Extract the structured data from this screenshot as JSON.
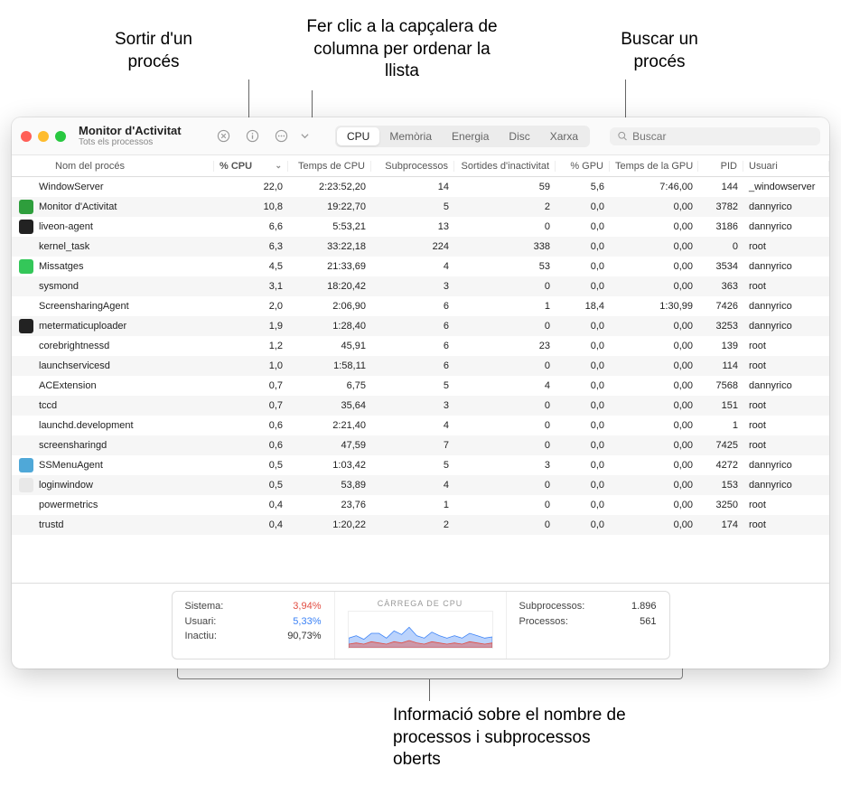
{
  "callouts": {
    "quit": "Sortir d'un\nprocés",
    "sort": "Fer clic a la capçalera\nde columna per\nordenar la llista",
    "search": "Buscar un\nprocés",
    "footer": "Informació sobre el\nnombre de processos\ni subprocessos oberts"
  },
  "titlebar": {
    "title": "Monitor d'Activitat",
    "subtitle": "Tots els processos"
  },
  "tabs": [
    "CPU",
    "Memòria",
    "Energia",
    "Disc",
    "Xarxa"
  ],
  "active_tab": 0,
  "search": {
    "placeholder": "Buscar"
  },
  "columns": [
    {
      "key": "name",
      "label": "Nom del procés"
    },
    {
      "key": "cpu",
      "label": "% CPU",
      "sorted": true
    },
    {
      "key": "cputime",
      "label": "Temps de CPU"
    },
    {
      "key": "threads",
      "label": "Subprocessos"
    },
    {
      "key": "idlewake",
      "label": "Sortides d'inactivitat"
    },
    {
      "key": "gpu",
      "label": "% GPU"
    },
    {
      "key": "gputime",
      "label": "Temps de la GPU"
    },
    {
      "key": "pid",
      "label": "PID"
    },
    {
      "key": "user",
      "label": "Usuari"
    }
  ],
  "rows": [
    {
      "icon": "",
      "name": "WindowServer",
      "cpu": "22,0",
      "cputime": "2:23:52,20",
      "threads": "14",
      "idlewake": "59",
      "gpu": "5,6",
      "gputime": "7:46,00",
      "pid": "144",
      "user": "_windowserver"
    },
    {
      "icon": "#2e9e3c",
      "name": "Monitor d'Activitat",
      "cpu": "10,8",
      "cputime": "19:22,70",
      "threads": "5",
      "idlewake": "2",
      "gpu": "0,0",
      "gputime": "0,00",
      "pid": "3782",
      "user": "dannyrico"
    },
    {
      "icon": "#222",
      "name": "liveon-agent",
      "cpu": "6,6",
      "cputime": "5:53,21",
      "threads": "13",
      "idlewake": "0",
      "gpu": "0,0",
      "gputime": "0,00",
      "pid": "3186",
      "user": "dannyrico"
    },
    {
      "icon": "",
      "name": "kernel_task",
      "cpu": "6,3",
      "cputime": "33:22,18",
      "threads": "224",
      "idlewake": "338",
      "gpu": "0,0",
      "gputime": "0,00",
      "pid": "0",
      "user": "root"
    },
    {
      "icon": "#34c759",
      "name": "Missatges",
      "cpu": "4,5",
      "cputime": "21:33,69",
      "threads": "4",
      "idlewake": "53",
      "gpu": "0,0",
      "gputime": "0,00",
      "pid": "3534",
      "user": "dannyrico"
    },
    {
      "icon": "",
      "name": "sysmond",
      "cpu": "3,1",
      "cputime": "18:20,42",
      "threads": "3",
      "idlewake": "0",
      "gpu": "0,0",
      "gputime": "0,00",
      "pid": "363",
      "user": "root"
    },
    {
      "icon": "",
      "name": "ScreensharingAgent",
      "cpu": "2,0",
      "cputime": "2:06,90",
      "threads": "6",
      "idlewake": "1",
      "gpu": "18,4",
      "gputime": "1:30,99",
      "pid": "7426",
      "user": "dannyrico"
    },
    {
      "icon": "#222",
      "name": "metermaticuploader",
      "cpu": "1,9",
      "cputime": "1:28,40",
      "threads": "6",
      "idlewake": "0",
      "gpu": "0,0",
      "gputime": "0,00",
      "pid": "3253",
      "user": "dannyrico"
    },
    {
      "icon": "",
      "name": "corebrightnessd",
      "cpu": "1,2",
      "cputime": "45,91",
      "threads": "6",
      "idlewake": "23",
      "gpu": "0,0",
      "gputime": "0,00",
      "pid": "139",
      "user": "root"
    },
    {
      "icon": "",
      "name": "launchservicesd",
      "cpu": "1,0",
      "cputime": "1:58,11",
      "threads": "6",
      "idlewake": "0",
      "gpu": "0,0",
      "gputime": "0,00",
      "pid": "114",
      "user": "root"
    },
    {
      "icon": "",
      "name": "ACExtension",
      "cpu": "0,7",
      "cputime": "6,75",
      "threads": "5",
      "idlewake": "4",
      "gpu": "0,0",
      "gputime": "0,00",
      "pid": "7568",
      "user": "dannyrico"
    },
    {
      "icon": "",
      "name": "tccd",
      "cpu": "0,7",
      "cputime": "35,64",
      "threads": "3",
      "idlewake": "0",
      "gpu": "0,0",
      "gputime": "0,00",
      "pid": "151",
      "user": "root"
    },
    {
      "icon": "",
      "name": "launchd.development",
      "cpu": "0,6",
      "cputime": "2:21,40",
      "threads": "4",
      "idlewake": "0",
      "gpu": "0,0",
      "gputime": "0,00",
      "pid": "1",
      "user": "root"
    },
    {
      "icon": "",
      "name": "screensharingd",
      "cpu": "0,6",
      "cputime": "47,59",
      "threads": "7",
      "idlewake": "0",
      "gpu": "0,0",
      "gputime": "0,00",
      "pid": "7425",
      "user": "root"
    },
    {
      "icon": "#4fa8d8",
      "name": "SSMenuAgent",
      "cpu": "0,5",
      "cputime": "1:03,42",
      "threads": "5",
      "idlewake": "3",
      "gpu": "0,0",
      "gputime": "0,00",
      "pid": "4272",
      "user": "dannyrico"
    },
    {
      "icon": "#e8e8e8",
      "name": "loginwindow",
      "cpu": "0,5",
      "cputime": "53,89",
      "threads": "4",
      "idlewake": "0",
      "gpu": "0,0",
      "gputime": "0,00",
      "pid": "153",
      "user": "dannyrico"
    },
    {
      "icon": "",
      "name": "powermetrics",
      "cpu": "0,4",
      "cputime": "23,76",
      "threads": "1",
      "idlewake": "0",
      "gpu": "0,0",
      "gputime": "0,00",
      "pid": "3250",
      "user": "root"
    },
    {
      "icon": "",
      "name": "trustd",
      "cpu": "0,4",
      "cputime": "1:20,22",
      "threads": "2",
      "idlewake": "0",
      "gpu": "0,0",
      "gputime": "0,00",
      "pid": "174",
      "user": "root"
    }
  ],
  "footer": {
    "stats": [
      {
        "label": "Sistema:",
        "value": "3,94%",
        "color": "#e24d42"
      },
      {
        "label": "Usuari:",
        "value": "5,33%",
        "color": "#3b82f6"
      },
      {
        "label": "Inactiu:",
        "value": "90,73%",
        "color": "#333"
      }
    ],
    "graph_title": "CÀRREGA DE CPU",
    "counts": [
      {
        "label": "Subprocessos:",
        "value": "1.896"
      },
      {
        "label": "Processos:",
        "value": "561"
      }
    ]
  },
  "chart_data": {
    "type": "area",
    "title": "CÀRREGA DE CPU",
    "xlabel": "",
    "ylabel": "%",
    "ylim": [
      0,
      30
    ],
    "series": [
      {
        "name": "Sistema",
        "color": "#e24d42",
        "values": [
          3,
          4,
          3,
          5,
          4,
          3,
          5,
          4,
          6,
          4,
          3,
          5,
          4,
          3,
          4,
          3,
          5,
          4,
          3,
          4
        ]
      },
      {
        "name": "Usuari",
        "color": "#3b82f6",
        "values": [
          5,
          6,
          4,
          7,
          8,
          5,
          9,
          7,
          11,
          6,
          5,
          8,
          6,
          5,
          6,
          5,
          7,
          6,
          5,
          5
        ]
      }
    ]
  }
}
